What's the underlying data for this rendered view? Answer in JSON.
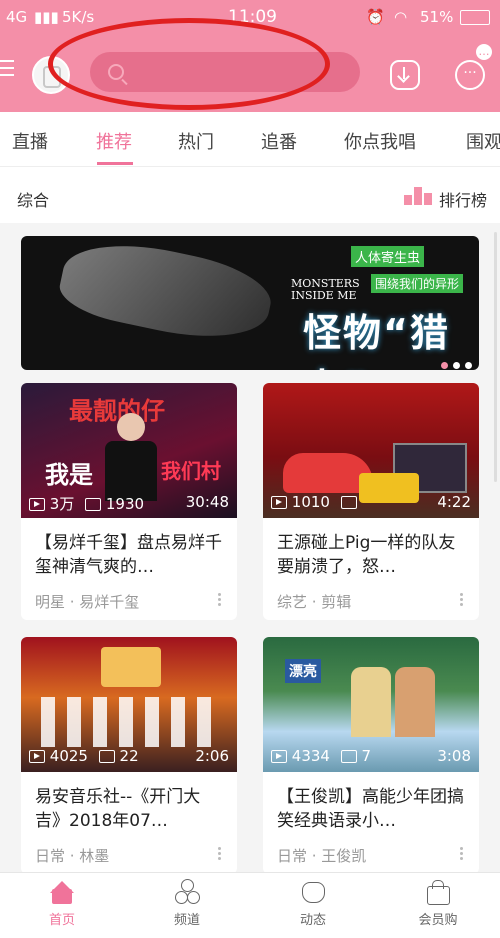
{
  "status": {
    "network": "4G",
    "speed": "5K/s",
    "time": "11:09",
    "battery": "51%"
  },
  "header": {
    "badge": "…"
  },
  "tabs": [
    "直播",
    "推荐",
    "热门",
    "追番",
    "你点我唱",
    "围观"
  ],
  "section": {
    "label": "综合",
    "ranking": "排行榜"
  },
  "banner": {
    "tag": "人体寄生虫",
    "english": "MONSTERS INSIDE ME",
    "subtitle": "围绕我们的异形",
    "title": "怪物“猎人”"
  },
  "cards": [
    {
      "thumb_text_1": "最靓的仔",
      "thumb_text_2": "我是",
      "thumb_text_3": "我们村",
      "plays": "3万",
      "comments": "1930",
      "duration": "30:48",
      "title": "【易烊千玺】盘点易烊千玺神清气爽的…",
      "tag": "明星 · 易烊千玺"
    },
    {
      "plays": "1010",
      "comments": "",
      "duration": "4:22",
      "title": "王源碰上Pig一样的队友要崩溃了，怒…",
      "tag": "综艺 · 剪辑"
    },
    {
      "plays": "4025",
      "comments": "22",
      "duration": "2:06",
      "title": "易安音乐社--《开门大吉》2018年07…",
      "tag": "日常 · 林墨"
    },
    {
      "thumb_text_1": "漂亮",
      "plays": "4334",
      "comments": "7",
      "duration": "3:08",
      "title": "【王俊凯】高能少年团搞笑经典语录小…",
      "tag": "日常 · 王俊凯"
    }
  ],
  "nav": [
    "首页",
    "频道",
    "动态",
    "会员购"
  ]
}
